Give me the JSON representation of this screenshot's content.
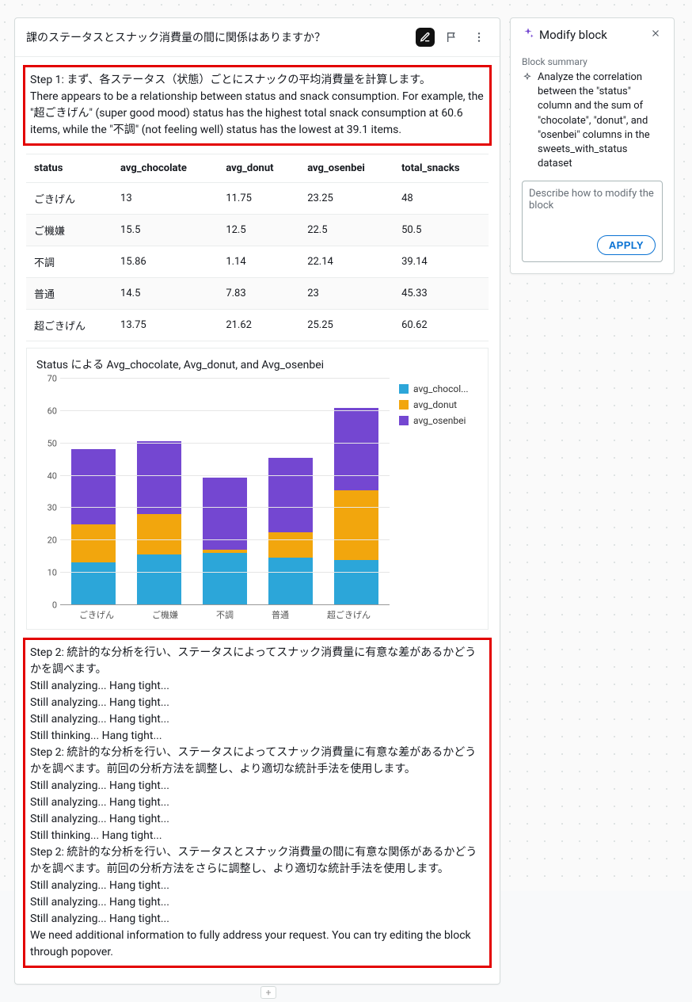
{
  "card": {
    "title": "課のステータスとスナック消費量の間に関係はありますか？"
  },
  "step1": {
    "heading": "Step 1: まず、各ステータス（状態）ごとにスナックの平均消費量を計算します。",
    "body": "There appears to be a relationship between status and snack consumption. For example, the \"超ごきげん\" (super good mood) status has the highest total snack consumption at 60.6 items, while the \"不調\" (not feeling well) status has the lowest at 39.1 items."
  },
  "table": {
    "headers": [
      "status",
      "avg_chocolate",
      "avg_donut",
      "avg_osenbei",
      "total_snacks"
    ],
    "rows": [
      [
        "ごきげん",
        "13",
        "11.75",
        "23.25",
        "48"
      ],
      [
        "ご機嫌",
        "15.5",
        "12.5",
        "22.5",
        "50.5"
      ],
      [
        "不調",
        "15.86",
        "1.14",
        "22.14",
        "39.14"
      ],
      [
        "普通",
        "14.5",
        "7.83",
        "23",
        "45.33"
      ],
      [
        "超ごきげん",
        "13.75",
        "21.62",
        "25.25",
        "60.62"
      ]
    ]
  },
  "chart": {
    "title": "Status による Avg_chocolate, Avg_donut, and Avg_osenbei",
    "legend": {
      "choc": "avg_chocol...",
      "donut": "avg_donut",
      "osen": "avg_osenbei"
    }
  },
  "chart_data": {
    "type": "bar",
    "stacked": true,
    "title": "Status による Avg_chocolate, Avg_donut, and Avg_osenbei",
    "xlabel": "",
    "ylabel": "",
    "ylim": [
      0,
      70
    ],
    "yticks": [
      0,
      10,
      20,
      30,
      40,
      50,
      60,
      70
    ],
    "categories": [
      "ごきげん",
      "ご機嫌",
      "不調",
      "普通",
      "超ごきげん"
    ],
    "series": [
      {
        "name": "avg_chocolate",
        "values": [
          13,
          15.5,
          15.86,
          14.5,
          13.75
        ]
      },
      {
        "name": "avg_donut",
        "values": [
          11.75,
          12.5,
          1.14,
          7.83,
          21.62
        ]
      },
      {
        "name": "avg_osenbei",
        "values": [
          23.25,
          22.5,
          22.14,
          23,
          25.25
        ]
      }
    ]
  },
  "log": [
    "Step 2: 統計的な分析を行い、ステータスによってスナック消費量に有意な差があるかどうかを調べます。",
    "Still analyzing... Hang tight...",
    "Still analyzing... Hang tight...",
    "Still analyzing... Hang tight...",
    "Still thinking... Hang tight...",
    "Step 2: 統計的な分析を行い、ステータスによってスナック消費量に有意な差があるかどうかを調べます。前回の分析方法を調整し、より適切な統計手法を使用します。",
    "Still analyzing... Hang tight...",
    "Still analyzing... Hang tight...",
    "Still analyzing... Hang tight...",
    "Still thinking... Hang tight...",
    "Step 2: 統計的な分析を行い、ステータスとスナック消費量の間に有意な関係があるかどうかを調べます。前回の分析方法をさらに調整し、より適切な統計手法を使用します。",
    "Still analyzing... Hang tight...",
    "Still analyzing... Hang tight...",
    "Still analyzing... Hang tight...",
    "We need additional information to fully address your request. You can try editing the block through popover."
  ],
  "side": {
    "title": "Modify block",
    "section_label": "Block summary",
    "summary": "Analyze the correlation between the \"status\" column and the sum of \"chocolate\", \"donut\", and \"osenbei\" columns in the sweets_with_status dataset",
    "placeholder": "Describe how to modify the block",
    "apply": "APPLY"
  }
}
